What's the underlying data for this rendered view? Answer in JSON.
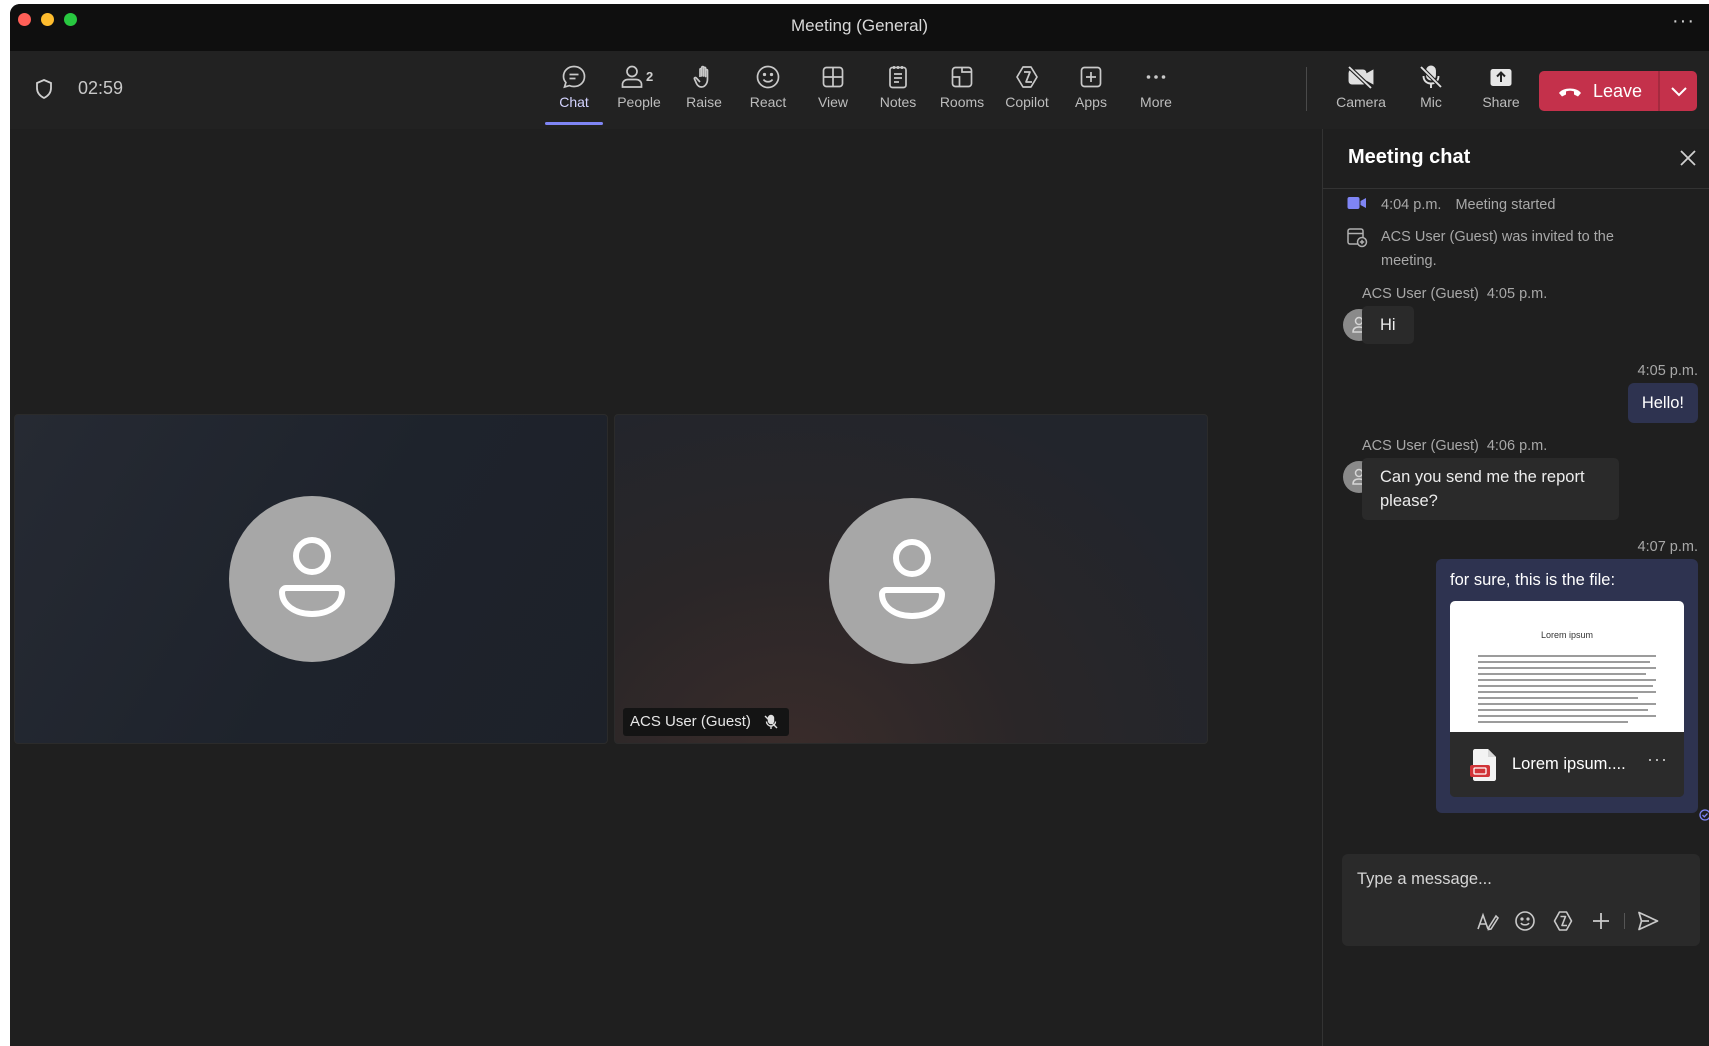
{
  "window": {
    "title": "Meeting (General)",
    "more_glyph": "···"
  },
  "toolbar": {
    "timer": "02:59",
    "items": [
      {
        "label": "Chat",
        "icon": "chat-icon"
      },
      {
        "label": "People",
        "icon": "people-icon",
        "count": "2"
      },
      {
        "label": "Raise",
        "icon": "raise-hand-icon"
      },
      {
        "label": "React",
        "icon": "react-icon"
      },
      {
        "label": "View",
        "icon": "view-icon"
      },
      {
        "label": "Notes",
        "icon": "notes-icon"
      },
      {
        "label": "Rooms",
        "icon": "rooms-icon"
      },
      {
        "label": "Copilot",
        "icon": "copilot-icon"
      },
      {
        "label": "Apps",
        "icon": "apps-icon"
      },
      {
        "label": "More",
        "icon": "more-icon"
      }
    ],
    "devices": [
      {
        "label": "Camera",
        "icon": "camera-off-icon"
      },
      {
        "label": "Mic",
        "icon": "mic-off-icon"
      },
      {
        "label": "Share",
        "icon": "share-icon"
      }
    ],
    "leave_label": "Leave",
    "leave_color": "#c4314b"
  },
  "stage": {
    "participant_name": "ACS User (Guest)"
  },
  "chat": {
    "title": "Meeting chat",
    "events": [
      {
        "time": "4:04 p.m.",
        "text": "Meeting started"
      },
      {
        "line1": "ACS User (Guest) was invited to the",
        "line2": "meeting."
      }
    ],
    "messages": [
      {
        "sender": "ACS User (Guest)",
        "time": "4:05 p.m.",
        "text": "Hi"
      },
      {
        "time": "4:05 p.m.",
        "text": "Hello!"
      },
      {
        "sender": "ACS User (Guest)",
        "time": "4:06 p.m.",
        "line1": "Can you send me the report",
        "line2": "please?"
      },
      {
        "time": "4:07 p.m.",
        "text": "for sure, this is the file:",
        "file": {
          "preview_title": "Lorem ipsum",
          "name": "Lorem ipsum....",
          "more": "···"
        }
      }
    ],
    "composer_placeholder": "Type a message..."
  },
  "colors": {
    "accent": "#7f85f5",
    "outgoing_bubble": "#2e3350",
    "background": "#1f1f1f"
  }
}
